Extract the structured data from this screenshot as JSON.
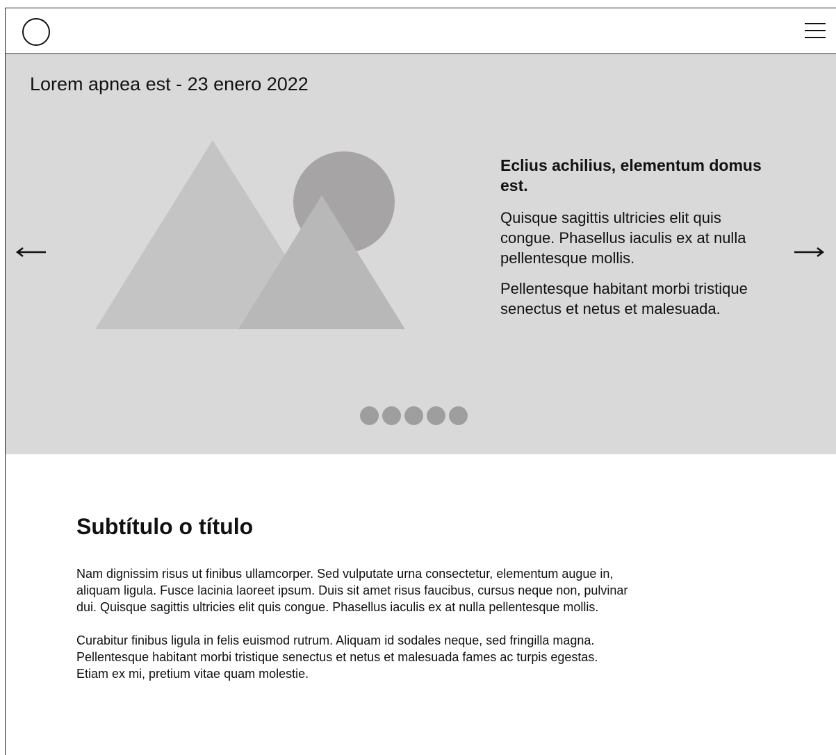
{
  "header": {
    "logo_icon": "circle-logo-icon",
    "menu_icon": "hamburger-menu-icon"
  },
  "hero": {
    "date_line": "Lorem apnea est - 23 enero 2022",
    "heading": "Eclius achilius, elementum domus est.",
    "paragraphs": [
      "Quisque sagittis ultricies elit quis congue. Phasellus iaculis ex at nulla pellentesque mollis.",
      "Pellentesque habitant morbi tristique senectus et netus et malesuada."
    ],
    "prev_icon": "arrow-left-icon",
    "next_icon": "arrow-right-icon",
    "dot_count": 5,
    "colors": {
      "background": "#d9d9d9",
      "mountain_back": "#c4c4c4",
      "mountain_front": "#b8b8b8",
      "sun": "#a6a4a4",
      "dot": "#9e9e9e"
    }
  },
  "content": {
    "subtitle": "Subtítulo o título",
    "paragraphs": [
      "Nam dignissim risus ut finibus ullamcorper. Sed vulputate urna consectetur, elementum augue in, aliquam ligula. Fusce lacinia laoreet ipsum. Duis sit amet risus faucibus, cursus neque non, pulvinar dui. Quisque sagittis ultricies elit quis congue. Phasellus iaculis ex at nulla pellentesque mollis.",
      "Curabitur finibus ligula in felis euismod rutrum. Aliquam id sodales neque, sed fringilla magna. Pellentesque habitant morbi tristique senectus et netus et malesuada fames ac turpis egestas. Etiam ex mi, pretium vitae quam molestie."
    ]
  }
}
